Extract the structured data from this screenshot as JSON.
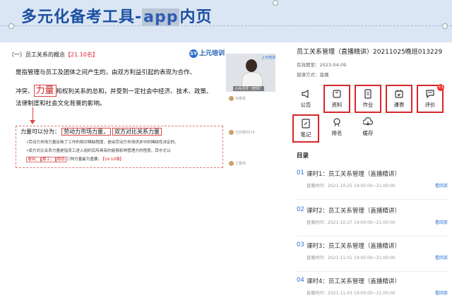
{
  "slide": {
    "title_prefix": "多元化备考工具-",
    "title_highlight": "app",
    "title_suffix": "内页"
  },
  "lesson": {
    "heading": "（一）员工关系的概念",
    "heading_tag": "【21.10名】",
    "line1": "是指管理与员工及团体之间产生的，由双方利益引起的表现为合作、",
    "line2_a": "冲突、",
    "line2_big": "力量",
    "line2_b": "和权利关系的总和，并受到一定社会中经济、技术、政策、",
    "line3": "法律制度和社会文化背景的影响。",
    "box_title": "力量可以分为：",
    "box_tag1": "劳动力市场力量，",
    "box_tag2": "双方对比关系力量",
    "bullet1": "•劳动力市场力量反映了工作的相对稀缺程度，是由劳动力市场供求中的稀缺性决定的。",
    "bullet2": "•双方对比关系力量是指员工进入组织后所具有的能够影响管理方的程度。其中尤以",
    "bullet3_a": "退出、",
    "bullet3_b": "罢工、",
    "bullet3_c": "抱怨",
    "bullet3_d": "三种力量最为重要。",
    "bullet3_tag": "【19.10填】",
    "logo_text": "上元培训",
    "logo_mark": "SY"
  },
  "camera": {
    "name": "小月月月（老师）",
    "logo": "上元培训"
  },
  "chat": {
    "items": [
      "许春看",
      "王欣颖6074",
      "丁春亮"
    ]
  },
  "course": {
    "title": "员工关系管理（直播精讲）20211025晚班013229",
    "valid_label": "有效期至：",
    "valid_value": "2023-04-09",
    "mode_label": "授课方式：",
    "mode_value": "直播"
  },
  "tools": [
    {
      "label": "公告",
      "icon": "announcement-icon"
    },
    {
      "label": "资料",
      "icon": "materials-icon"
    },
    {
      "label": "作业",
      "icon": "homework-icon"
    },
    {
      "label": "课表",
      "icon": "schedule-icon"
    },
    {
      "label": "评价",
      "icon": "review-icon",
      "badge": "+1"
    },
    {
      "label": "笔记",
      "icon": "notes-icon"
    },
    {
      "label": "排名",
      "icon": "ranking-icon"
    },
    {
      "label": "缓存",
      "icon": "cache-icon"
    }
  ],
  "toc": {
    "label": "目录",
    "items": [
      {
        "num": "01",
        "name": "课时1：员工关系管理（直播精讲）",
        "time": "直播时间：2021-10-25 19:00:00~21:00:00",
        "btn": "看回放"
      },
      {
        "num": "02",
        "name": "课时2：员工关系管理（直播精讲）",
        "time": "直播时间：2021-10-27 19:00:00~21:00:00",
        "btn": "看回放"
      },
      {
        "num": "03",
        "name": "课时3：员工关系管理（直播精讲）",
        "time": "直播时间：2021-11-01 19:00:00~21:00:00",
        "btn": "看回放"
      },
      {
        "num": "04",
        "name": "课时4：员工关系管理（直播精讲）",
        "time": "直播时间：2021-11-03 19:00:00~21:00:00",
        "btn": "看回放"
      }
    ]
  },
  "colors": {
    "title_blue": "#1b4fa0",
    "accent_blue": "#2d6fd6",
    "highlight_red": "#d8262b"
  }
}
